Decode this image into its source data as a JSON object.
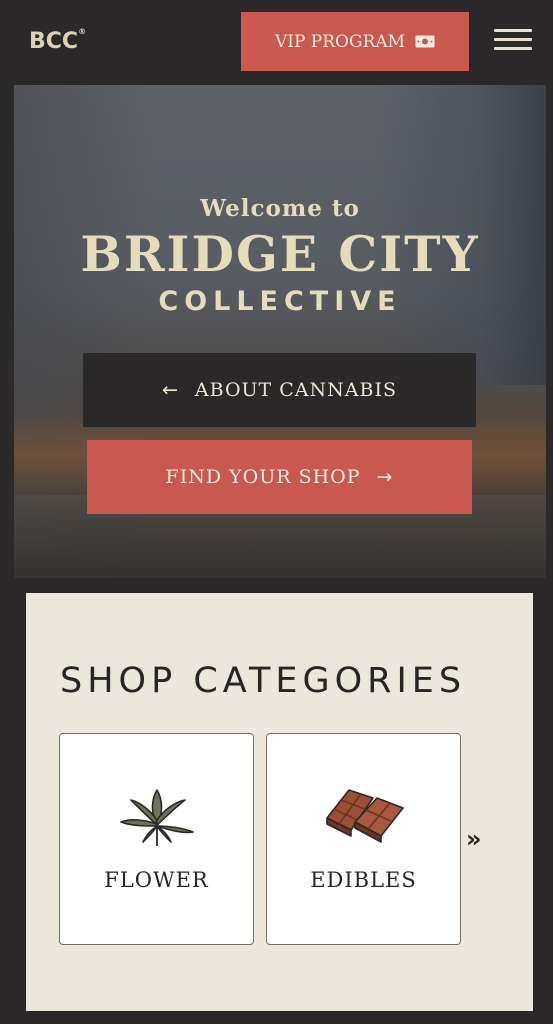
{
  "header": {
    "logo_text": "BCC",
    "logo_mark": "®",
    "vip_label": "VIP PROGRAM",
    "vip_icon": "ticket-icon",
    "menu_icon": "hamburger-icon"
  },
  "hero": {
    "welcome": "Welcome to",
    "brand_main": "BRIDGE CITY",
    "brand_sub": "COLLECTIVE",
    "about_label": "ABOUT CANNABIS",
    "about_icon": "arrow-left-icon",
    "shop_label": "FIND YOUR SHOP",
    "shop_icon": "arrow-right-icon"
  },
  "categories": {
    "title": "SHOP CATEGORIES",
    "items": [
      {
        "label": "FLOWER",
        "icon": "cannabis-leaf-icon"
      },
      {
        "label": "EDIBLES",
        "icon": "chocolate-icon"
      }
    ],
    "next_icon": "double-chevron-right-icon",
    "next_glyph": "»"
  },
  "colors": {
    "background": "#2a2828",
    "accent": "#c9584f",
    "cream": "#e6dcbc",
    "panel": "#ebe7dd"
  }
}
